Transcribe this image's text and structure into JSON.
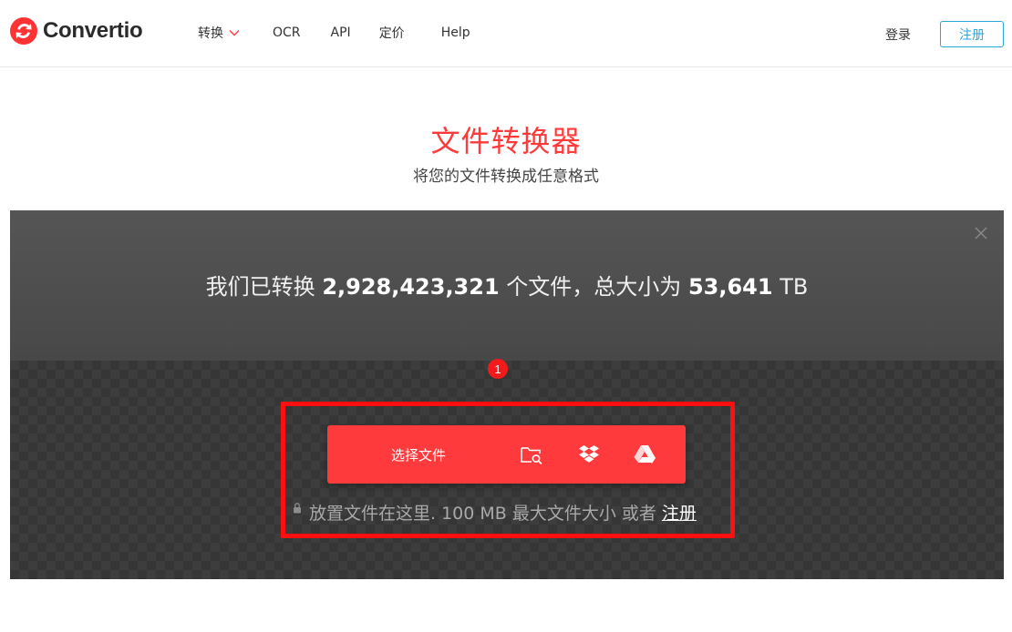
{
  "app": {
    "brand": "Convertio",
    "accent_color": "#ff3a3d",
    "signup_color": "#2aa6d9"
  },
  "nav": {
    "items": [
      {
        "label": "转换",
        "has_dropdown": true
      },
      {
        "label": "OCR"
      },
      {
        "label": "API"
      },
      {
        "label": "定价"
      },
      {
        "label": "Help"
      }
    ],
    "login": "登录",
    "signup": "注册"
  },
  "hero": {
    "title": "文件转换器",
    "subtitle": "将您的文件转换成任意格式"
  },
  "stats": {
    "prefix": "我们已转换",
    "files_count": "2,928,423,321",
    "middle": "个文件，总大小为",
    "total_size": "53,641",
    "unit": "TB"
  },
  "upload": {
    "step_number": "1",
    "choose_files": "选择文件",
    "sources": [
      "folder-search-icon",
      "dropbox-icon",
      "google-drive-icon"
    ],
    "hint": "放置文件在这里. 100 MB 最大文件大小 或者",
    "signup_link": "注册"
  }
}
